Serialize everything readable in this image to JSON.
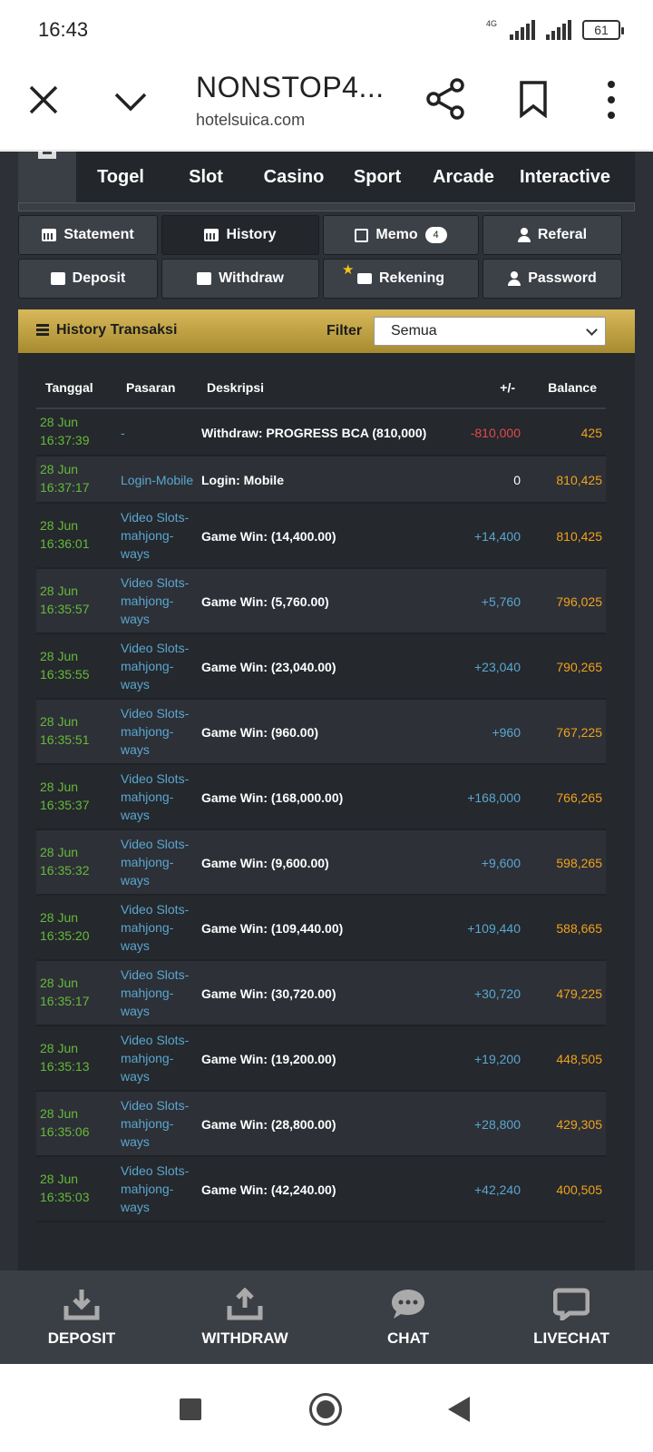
{
  "status": {
    "time": "16:43",
    "network": "4G",
    "battery": "61"
  },
  "browser": {
    "title": "NONSTOP4...",
    "url": "hotelsuica.com"
  },
  "nav": [
    "Togel",
    "Slot",
    "Casino",
    "Sport",
    "Arcade",
    "Interactive"
  ],
  "buttons": {
    "statement": "Statement",
    "history": "History",
    "memo": "Memo",
    "memo_count": "4",
    "referal": "Referal",
    "deposit": "Deposit",
    "withdraw": "Withdraw",
    "rekening": "Rekening",
    "password": "Password"
  },
  "history": {
    "title": "History Transaksi",
    "filter_label": "Filter",
    "filter_value": "Semua",
    "columns": [
      "Tanggal",
      "Pasaran",
      "Deskripsi",
      "+/-",
      "Balance"
    ],
    "rows": [
      {
        "date": "28 Jun",
        "time": "16:37:39",
        "pasaran": [
          "-"
        ],
        "desc": "Withdraw: PROGRESS BCA (810,000)",
        "amount": "-810,000",
        "balance": "425"
      },
      {
        "date": "28 Jun",
        "time": "16:37:17",
        "pasaran": [
          "Login-Mobile"
        ],
        "desc": "Login: Mobile",
        "amount": "0",
        "balance": "810,425"
      },
      {
        "date": "28 Jun",
        "time": "16:36:01",
        "pasaran": [
          "Video Slots-",
          "mahjong-",
          "ways"
        ],
        "desc": "Game Win: (14,400.00)",
        "amount": "+14,400",
        "balance": "810,425"
      },
      {
        "date": "28 Jun",
        "time": "16:35:57",
        "pasaran": [
          "Video Slots-",
          "mahjong-",
          "ways"
        ],
        "desc": "Game Win: (5,760.00)",
        "amount": "+5,760",
        "balance": "796,025"
      },
      {
        "date": "28 Jun",
        "time": "16:35:55",
        "pasaran": [
          "Video Slots-",
          "mahjong-",
          "ways"
        ],
        "desc": "Game Win: (23,040.00)",
        "amount": "+23,040",
        "balance": "790,265"
      },
      {
        "date": "28 Jun",
        "time": "16:35:51",
        "pasaran": [
          "Video Slots-",
          "mahjong-",
          "ways"
        ],
        "desc": "Game Win: (960.00)",
        "amount": "+960",
        "balance": "767,225"
      },
      {
        "date": "28 Jun",
        "time": "16:35:37",
        "pasaran": [
          "Video Slots-",
          "mahjong-",
          "ways"
        ],
        "desc": "Game Win: (168,000.00)",
        "amount": "+168,000",
        "balance": "766,265"
      },
      {
        "date": "28 Jun",
        "time": "16:35:32",
        "pasaran": [
          "Video Slots-",
          "mahjong-",
          "ways"
        ],
        "desc": "Game Win: (9,600.00)",
        "amount": "+9,600",
        "balance": "598,265"
      },
      {
        "date": "28 Jun",
        "time": "16:35:20",
        "pasaran": [
          "Video Slots-",
          "mahjong-",
          "ways"
        ],
        "desc": "Game Win: (109,440.00)",
        "amount": "+109,440",
        "balance": "588,665"
      },
      {
        "date": "28 Jun",
        "time": "16:35:17",
        "pasaran": [
          "Video Slots-",
          "mahjong-",
          "ways"
        ],
        "desc": "Game Win: (30,720.00)",
        "amount": "+30,720",
        "balance": "479,225"
      },
      {
        "date": "28 Jun",
        "time": "16:35:13",
        "pasaran": [
          "Video Slots-",
          "mahjong-",
          "ways"
        ],
        "desc": "Game Win: (19,200.00)",
        "amount": "+19,200",
        "balance": "448,505"
      },
      {
        "date": "28 Jun",
        "time": "16:35:06",
        "pasaran": [
          "Video Slots-",
          "mahjong-",
          "ways"
        ],
        "desc": "Game Win: (28,800.00)",
        "amount": "+28,800",
        "balance": "429,305"
      },
      {
        "date": "28 Jun",
        "time": "16:35:03",
        "pasaran": [
          "Video Slots-",
          "mahjong-",
          "ways"
        ],
        "desc": "Game Win: (42,240.00)",
        "amount": "+42,240",
        "balance": "400,505"
      }
    ]
  },
  "bottom_menu": [
    "DEPOSIT",
    "WITHDRAW",
    "CHAT",
    "LIVECHAT"
  ],
  "colors": {
    "gold": "#c9a845",
    "date_green": "#67b93a",
    "link_blue": "#5aa7d0",
    "balance_orange": "#f0a21d",
    "negative_red": "#e04a4a"
  }
}
